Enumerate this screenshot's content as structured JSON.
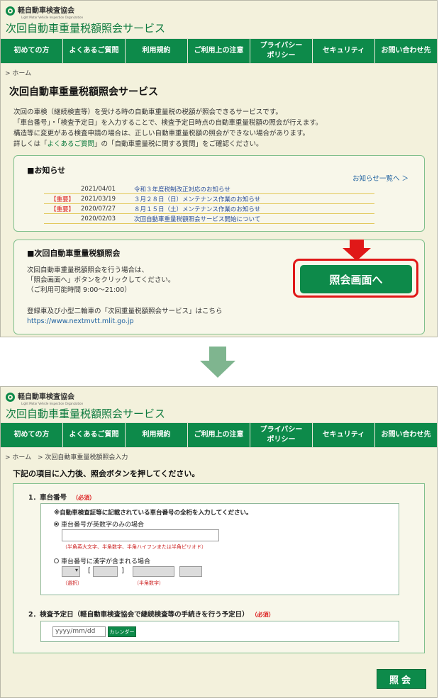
{
  "logo": {
    "org_name": "軽自動車検査協会",
    "org_sub": "Light Motor Vehicle Inspection Organization"
  },
  "site_title": "次回自動車重量税額照会サービス",
  "nav": [
    {
      "label": "初めての方"
    },
    {
      "label": "よくあるご質問"
    },
    {
      "label": "利用規約"
    },
    {
      "label": "ご利用上の注意"
    },
    {
      "label": "プライバシー\nポリシー"
    },
    {
      "label": "セキュリティ"
    },
    {
      "label": "お問い合わせ先"
    }
  ],
  "top": {
    "breadcrumb": "> ホーム",
    "heading": "次回自動車重量税額照会サービス",
    "intro_line1": "次回の車検（継続検査等）を受ける時の自動車重量税の税額が照会できるサービスです。",
    "intro_line2": "「車台番号」・「検査予定日」を入力することで、検査予定日時点の自動車重量税額の照会が行えます。",
    "intro_line3": "構造等に変更がある検査申請の場合は、正しい自動車重量税額の照会ができない場合があります。",
    "intro_line4_a": "詳しくは「",
    "intro_line4_link": "よくあるご質問",
    "intro_line4_b": "」の「自動車重量税に関する質問」をご確認ください。",
    "news": {
      "title": "■お知らせ",
      "list_link": "お知らせ一覧へ ＞",
      "items": [
        {
          "tag": "",
          "date": "2021/04/01",
          "text": "令和３年度税制改正対応のお知らせ"
        },
        {
          "tag": "【重要】",
          "date": "2021/03/19",
          "text": "３月２８日（日）メンテナンス作業のお知らせ"
        },
        {
          "tag": "【重要】",
          "date": "2020/07/27",
          "text": "８月１５日（土）メンテナンス作業のお知らせ"
        },
        {
          "tag": "",
          "date": "2020/02/03",
          "text": "次回自動車重量税額照会サービス開始について"
        }
      ]
    },
    "inquiry": {
      "title": "■次回自動車重量税額照会",
      "line1": "次回自動車重量税額照会を行う場合は、",
      "line2": "「照会画面へ」ボタンをクリックしてください。",
      "line3": "（ご利用可能時間 9:00～21:00）",
      "line4": "登録車及び小型二輪車の「次回重量税額照会サービス」はこちら",
      "url": "https://www.nextmvtt.mlit.go.jp",
      "button": "照会画面へ"
    }
  },
  "bottom": {
    "breadcrumb_home": "> ホーム",
    "breadcrumb_current": "> 次回自動車重量税額照会入力",
    "instruction": "下記の項目に入力後、照会ボタンを押してください。",
    "q1": {
      "label": "1．車台番号",
      "required": "（必須）",
      "note": "※自動車検査証等に記載されている車台番号の全桁を入力してください。",
      "option_alnum": "車台番号が英数字のみの場合",
      "hint_alnum": "（半角英大文字、半角数字、半角ハイフンまたは半角ピリオド）",
      "option_kanji": "車台番号に漢字が含まれる場合",
      "bracket_open": "[",
      "bracket_close": "]",
      "hint_select": "（選択）",
      "hint_numeric": "（半角数字）"
    },
    "q2": {
      "label": "2．検査予定日（軽自動車検査協会で継続検査等の手続きを行う予定日）",
      "required": "（必須）",
      "placeholder": "yyyy/mm/dd",
      "calendar_button": "カレンダー"
    },
    "submit": "照会"
  },
  "colors": {
    "brand_green": "#0d8a4a",
    "panel_bg": "#f3f1dc",
    "highlight_red": "#e01818"
  }
}
